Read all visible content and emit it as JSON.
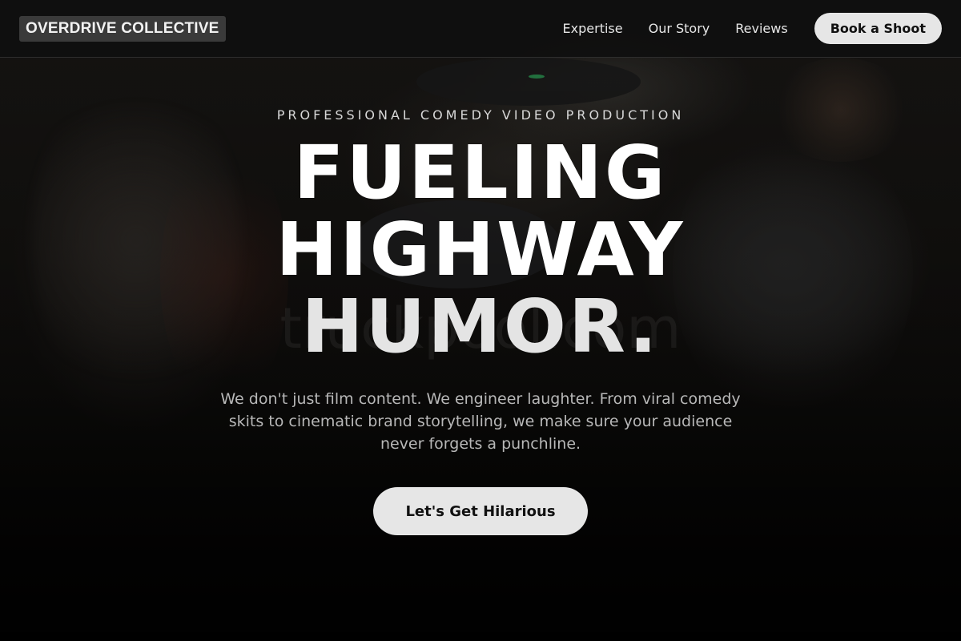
{
  "nav": {
    "logo": "OVERDRIVE COLLECTIVE",
    "links": [
      "Expertise",
      "Our Story",
      "Reviews"
    ],
    "cta_label": "Book a Shoot"
  },
  "hero": {
    "kicker": "PROFESSIONAL COMEDY VIDEO PRODUCTION",
    "headline_lines": [
      "FUELING",
      "HIGHWAY",
      "HUMOR."
    ],
    "subtext": "We don't just film content. We engineer laughter. From viral comedy skits to cinematic brand storytelling, we make sure your audience never forgets a punchline.",
    "cta_label": "Let's Get Hilarious",
    "watermark": "truckpool.com"
  },
  "colors": {
    "nav_background": "#0f0f0f",
    "button_background": "#e6e6e6",
    "button_text": "#111111",
    "subtext": "#b8b8b8"
  }
}
